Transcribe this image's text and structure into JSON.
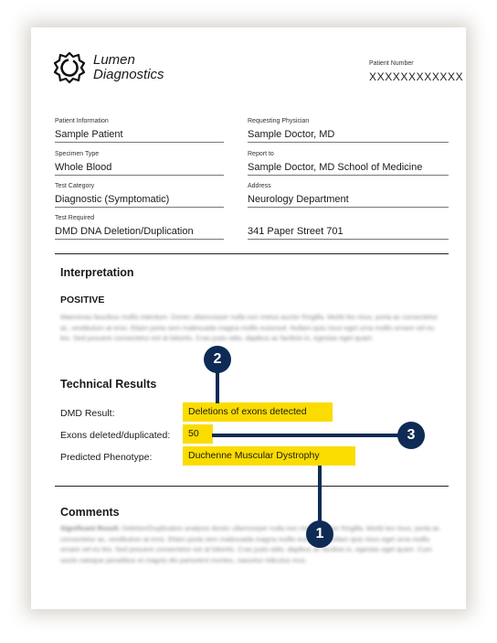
{
  "brand": {
    "name_line1": "Lumen",
    "name_line2": "Diagnostics",
    "logo_icon": "sun-gear-icon"
  },
  "patient_number": {
    "label": "Patient Number",
    "value": "XXXXXXXXXXXX"
  },
  "fields_left": [
    {
      "label": "Patient Information",
      "value": "Sample Patient"
    },
    {
      "label": "Specimen Type",
      "value": "Whole Blood"
    },
    {
      "label": "Test Category",
      "value": "Diagnostic (Symptomatic)"
    },
    {
      "label": "Test Required",
      "value": "DMD DNA Deletion/Duplication"
    }
  ],
  "fields_right": [
    {
      "label": "Requesting Physician",
      "value": "Sample Doctor, MD"
    },
    {
      "label": "Report to",
      "value": "Sample Doctor, MD School of Medicine"
    },
    {
      "label": "Address",
      "value": "Neurology Department"
    },
    {
      "label": "",
      "value": "341 Paper Street 701"
    }
  ],
  "interpretation": {
    "heading": "Interpretation",
    "status": "POSITIVE",
    "body": "Maecenas faucibus mollis interdum. Donec ullamcorper nulla non metus auctor fringilla. Morbi leo risus, porta ac consectetur ac, vestibulum at eros. Etiam porta sem malesuada magna mollis euismod. Nullam quis risus eget urna mollis ornare vel eu leo. Sed posuere consectetur est at lobortis. Cras justo odio, dapibus ac facilisis in, egestas eget quam."
  },
  "technical_results": {
    "heading": "Technical Results",
    "rows": [
      {
        "label": "DMD Result:",
        "value": "Deletions of exons detected"
      },
      {
        "label": "Exons deleted/duplicated:",
        "value": "50"
      },
      {
        "label": "Predicted Phenotype:",
        "value": "Duchenne Muscular Dystrophy"
      }
    ]
  },
  "comments": {
    "heading": "Comments",
    "lead": "Significant Result.",
    "body": "Deletion/Duplication analysis donec ullamcorper nulla non metus auctor fringilla. Morbi leo risus, porta ac consectetur ac, vestibulum at eros. Etiam porta sem malesuada magna mollis euismod. Nullam quis risus eget urna mollis ornare vel eu leo. Sed posuere consectetur est at lobortis. Cras justo odio, dapibus ac facilisis in, egestas eget quam. Cum sociis natoque penatibus et magnis dis parturient montes, nascetur ridiculus mus."
  },
  "callouts": [
    "1",
    "2",
    "3"
  ],
  "colors": {
    "highlight": "#fbdc00",
    "callout": "#0d2b55"
  }
}
